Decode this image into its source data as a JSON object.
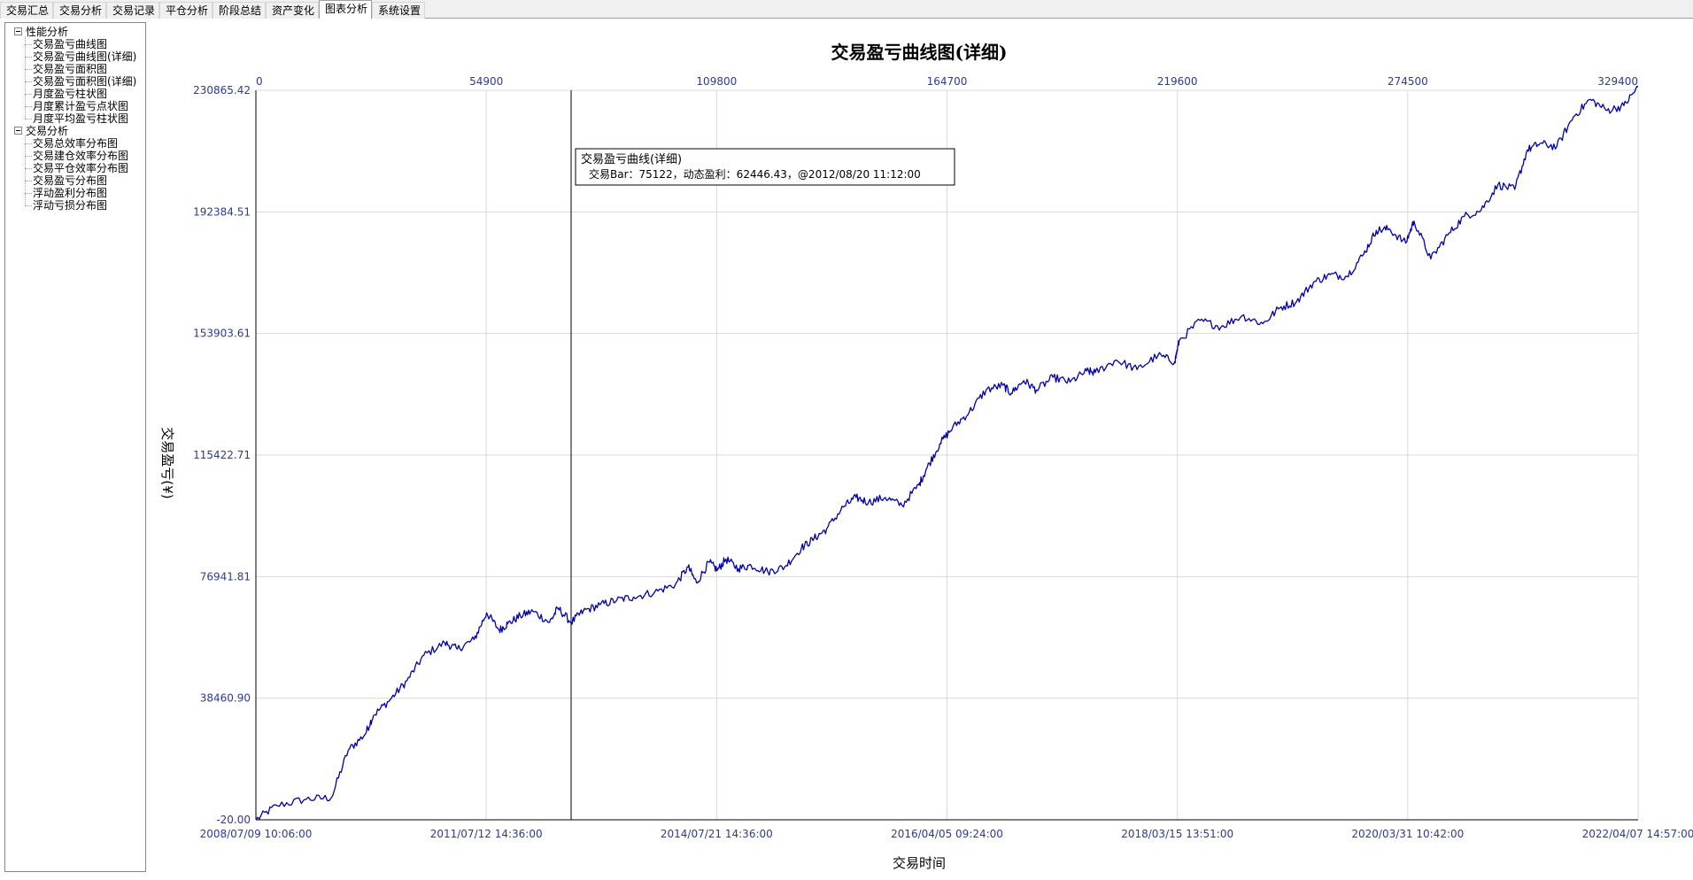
{
  "tabs": [
    "交易汇总",
    "交易分析",
    "交易记录",
    "平仓分析",
    "阶段总结",
    "资产变化",
    "图表分析",
    "系统设置"
  ],
  "active_tab": "图表分析",
  "tree": {
    "groups": [
      {
        "label": "性能分析",
        "items": [
          "交易盈亏曲线图",
          "交易盈亏曲线图(详细)",
          "交易盈亏面积图",
          "交易盈亏面积图(详细)",
          "月度盈亏柱状图",
          "月度累计盈亏点状图",
          "月度平均盈亏柱状图"
        ]
      },
      {
        "label": "交易分析",
        "items": [
          "交易总效率分布图",
          "交易建仓效率分布图",
          "交易平仓效率分布图",
          "交易盈亏分布图",
          "浮动盈利分布图",
          "浮动亏损分布图"
        ]
      }
    ]
  },
  "colors": {
    "series": "#0000a8",
    "axis_text": "#2b3a9b",
    "grid": "#d9d9d9",
    "cursor": "#000000"
  },
  "chart_data": {
    "type": "line",
    "title": "交易盈亏曲线图(详细)",
    "xlabel": "交易时间",
    "ylabel": "交易盈亏(¥)",
    "y_ticks": [
      "-20.00",
      "38460.90",
      "76941.81",
      "115422.71",
      "153903.61",
      "192384.51",
      "230865.42"
    ],
    "ylim": [
      -20.0,
      230865.42
    ],
    "x_top_ticks": [
      "0",
      "54900",
      "109800",
      "164700",
      "219600",
      "274500",
      "329400"
    ],
    "x_bottom_ticks": [
      "2008/07/09 10:06:00",
      "2011/07/12 14:36:00",
      "2014/07/21 14:36:00",
      "2016/04/05 09:24:00",
      "2018/03/15 13:51:00",
      "2020/03/31 10:42:00",
      "2022/04/07 14:57:00"
    ],
    "xlim": [
      0,
      329400
    ],
    "grid": true,
    "series": [
      {
        "x": [
          0,
          5000,
          12000,
          18000,
          22000,
          26000,
          28000,
          32000,
          36000,
          40000,
          45000,
          48000,
          52000,
          55000,
          58000,
          60000,
          63000,
          66000,
          70000,
          72000,
          75122,
          78000,
          82000,
          86000,
          90000,
          95000,
          100000,
          103000,
          105000,
          108000,
          110000,
          112000,
          115000,
          118000,
          122000,
          126000,
          130000,
          133000,
          136000,
          140000,
          143000,
          146000,
          150000,
          154000,
          158000,
          160000,
          163000,
          166000,
          170000,
          174000,
          178000,
          180000,
          183000,
          186000,
          190000,
          194000,
          198000,
          200000,
          205000,
          210000,
          215000,
          219000,
          220000,
          225000,
          230000,
          235000,
          240000,
          244000,
          248000,
          252000,
          256000,
          260000,
          264000,
          267000,
          270000,
          274000,
          276000,
          280000,
          284000,
          288000,
          292000,
          296000,
          300000,
          303000,
          306000,
          310000,
          314000,
          318000,
          322000,
          326000,
          329400
        ],
        "y": [
          -20,
          4500,
          6500,
          7000,
          22000,
          27000,
          33000,
          38000,
          44000,
          52000,
          56000,
          54000,
          57000,
          65500,
          60000,
          62000,
          64500,
          66000,
          62500,
          67000,
          62446,
          66000,
          68000,
          69500,
          70500,
          72000,
          74500,
          80000,
          75000,
          81500,
          79000,
          82500,
          79500,
          80500,
          78500,
          80000,
          86000,
          89000,
          92000,
          99000,
          102000,
          100500,
          102000,
          99500,
          106000,
          111500,
          119000,
          124000,
          129000,
          136000,
          137500,
          135000,
          139000,
          136000,
          140000,
          138500,
          142000,
          141500,
          145500,
          142500,
          147000,
          145000,
          151500,
          158000,
          156000,
          159500,
          157000,
          162000,
          164000,
          170000,
          172500,
          172000,
          179000,
          186500,
          187000,
          182500,
          189500,
          177500,
          185000,
          191000,
          193000,
          201000,
          199500,
          212000,
          214000,
          213000,
          222500,
          228000,
          224500,
          226000,
          232000
        ]
      }
    ],
    "cursor": {
      "x": 75122,
      "label_title": "交易盈亏曲线(详细)",
      "label_text": "交易Bar：75122，动态盈利：62446.43，@2012/08/20 11:12:00"
    }
  }
}
